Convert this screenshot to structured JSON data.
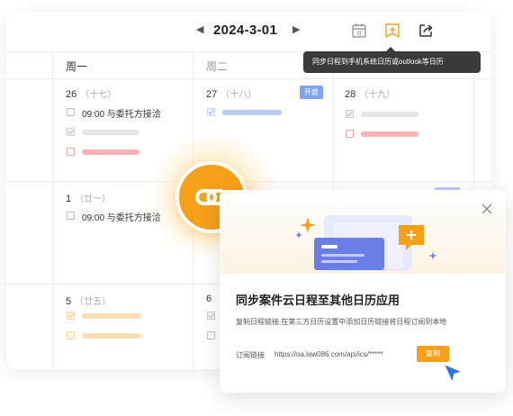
{
  "toolbar": {
    "prev_icon": "caret-left-icon",
    "next_icon": "caret-right-icon",
    "date": "2024-3-01",
    "calendar_icon": "calendar-icon",
    "sync_icon": "bookmark-plus-icon",
    "share_icon": "share-icon",
    "tooltip": "同步日程到手机系统日历或outlook等日历",
    "calendar_icon_text": "日"
  },
  "weekdays": [
    "周一",
    "周二"
  ],
  "days": {
    "d26": {
      "num": "26",
      "lunar": "（十七）"
    },
    "d27": {
      "num": "27",
      "lunar": "（十八）",
      "badge": "开庭"
    },
    "d28": {
      "num": "28",
      "lunar": "（十九）"
    },
    "d1": {
      "num": "1",
      "lunar": "（廿一）"
    },
    "d5": {
      "num": "5",
      "lunar": "（廿五）"
    },
    "d6": {
      "num": "6"
    }
  },
  "events": {
    "e1": "09:00  与委托方接洽",
    "e2": "09:00  与委托方接洽"
  },
  "colors": {
    "accent": "#f6a01a",
    "red_pill": "#f8b4b4",
    "blue_pill": "#b9ccf5",
    "gray_pill": "#e6e6e6",
    "orange_pill": "#f8dfb0",
    "badge": "#7da4ee"
  },
  "link_button": {
    "icon": "link-icon"
  },
  "popup": {
    "title": "同步案件云日程至其他日历应用",
    "description": "复制日程链接,在第三方日历设置中添加日历链接将日程订阅到本地",
    "link_label": "订阅链接",
    "link_url": "https://oa.law086.com/api/ics/*****",
    "copy_label": "复制",
    "close_icon": "close-icon",
    "hero_icon": "calendar-add-icon"
  },
  "cursor_icon": "pointer-cursor-icon"
}
